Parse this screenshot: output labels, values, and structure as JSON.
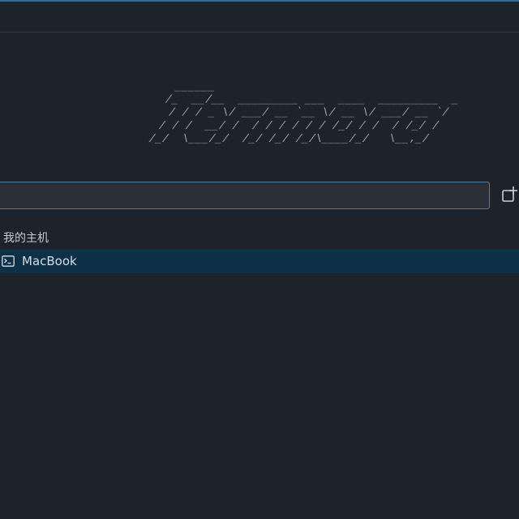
{
  "logo": {
    "ascii": "           ______                             \n          /_  __/__  _________ ___  ____  _________  _\n           / / / _ \\/ ___/ __ `__ \\/ __ \\/ ___/ __ `/\n          / / /  __/ /  / / / / / / /_/ / /  / /_/ / \n         /_/  \\___/_/  /_/ /_/ /_/\\____/_/   \\__,_/  "
  },
  "search": {
    "value": "",
    "placeholder": ""
  },
  "toolbar": {
    "new_tab_icon": "new-tab-plus-icon"
  },
  "hosts": {
    "group_label": "我的主机",
    "items": [
      {
        "label": "MacBook",
        "icon": "terminal-icon",
        "selected": true
      }
    ]
  },
  "colors": {
    "background": "#1e222a",
    "accent": "#2f6f9a",
    "selected_row": "#0f3148",
    "input_border": "#4f7da8"
  }
}
